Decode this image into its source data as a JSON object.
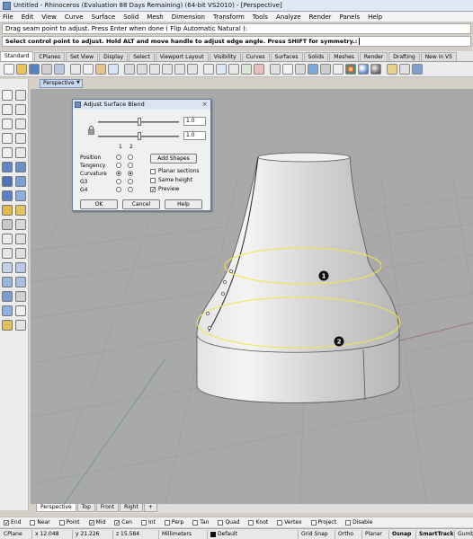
{
  "window": {
    "title": "Untitled - Rhinoceros (Evaluation 88 Days Remaining) (64-bit VS2010) - [Perspective]"
  },
  "menu": [
    "File",
    "Edit",
    "View",
    "Curve",
    "Surface",
    "Solid",
    "Mesh",
    "Dimension",
    "Transform",
    "Tools",
    "Analyze",
    "Render",
    "Panels",
    "Help"
  ],
  "command": {
    "history": "Drag seam point to adjust. Press Enter when done ( Flip  Automatic  Natural ):",
    "prompt": "Select control point to adjust. Hold ALT and move handle to adjust edge angle. Press SHIFT for symmetry.:"
  },
  "toolbar_tabs": [
    "Standard",
    "CPlanes",
    "Set View",
    "Display",
    "Select",
    "Viewport Layout",
    "Visibility",
    "Curves",
    "Surfaces",
    "Solids",
    "Meshes",
    "Render",
    "Drafting",
    "New in V5"
  ],
  "toolbar_tab_active": "Standard",
  "viewport": {
    "active_tab": "Perspective",
    "markers": [
      "1",
      "2"
    ]
  },
  "dialog": {
    "title": "Adjust Surface Blend",
    "value1": "1.0",
    "value2": "1.0",
    "col_labels": [
      "1",
      "2"
    ],
    "continuity_labels": [
      "Position",
      "Tangency",
      "Curvature",
      "G3",
      "G4"
    ],
    "selected_continuity": "Curvature",
    "add_shapes_label": "Add Shapes",
    "checkboxes": [
      {
        "label": "Planar sections",
        "checked": false
      },
      {
        "label": "Same height",
        "checked": false
      },
      {
        "label": "Preview",
        "checked": true
      }
    ],
    "ok_label": "OK",
    "cancel_label": "Cancel",
    "help_label": "Help"
  },
  "viewport_tabs": [
    "Perspective",
    "Top",
    "Front",
    "Right"
  ],
  "viewport_tab_add": "+",
  "osnaps": [
    {
      "label": "End",
      "checked": true
    },
    {
      "label": "Near",
      "checked": false
    },
    {
      "label": "Point",
      "checked": false
    },
    {
      "label": "Mid",
      "checked": true
    },
    {
      "label": "Cen",
      "checked": true
    },
    {
      "label": "Int",
      "checked": false
    },
    {
      "label": "Perp",
      "checked": false
    },
    {
      "label": "Tan",
      "checked": false
    },
    {
      "label": "Quad",
      "checked": false
    },
    {
      "label": "Knot",
      "checked": false
    },
    {
      "label": "Vertex",
      "checked": false
    },
    {
      "label": "Project",
      "checked": false
    },
    {
      "label": "Disable",
      "checked": false
    }
  ],
  "status": {
    "cplane": "CPlane",
    "x": "x 12.048",
    "y": "y 21.226",
    "z": "z 15.584",
    "units": "Millimeters",
    "layer": "Default",
    "grid_snap": "Grid Snap",
    "ortho": "Ortho",
    "planar": "Planar",
    "osnap": "Osnap",
    "smarttrack": "SmartTrack",
    "gumball": "Gumball"
  },
  "colors": {
    "viewport_bg": "#a9a9a9",
    "grid": "#9c9c9c",
    "highlight_curve": "#f2e64a",
    "surface_light": "#f3f3f3",
    "surface_shade": "#bcbcbc"
  }
}
